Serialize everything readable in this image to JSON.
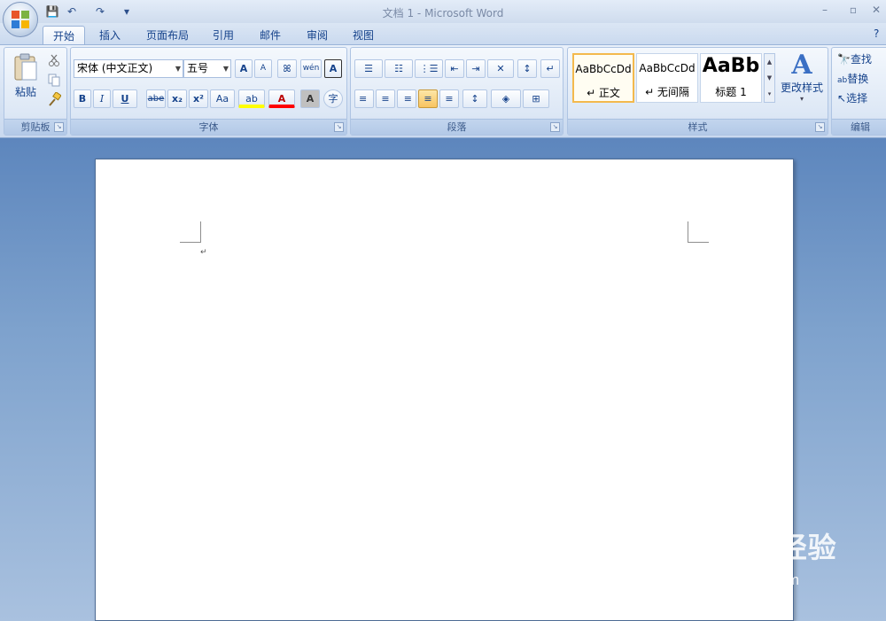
{
  "window": {
    "title": "文档 1 - Microsoft Word",
    "min": "–",
    "restore": "▫",
    "close": "✕"
  },
  "qat": {
    "save": "💾",
    "undo": "↶",
    "redo": "↷",
    "customize": "▾"
  },
  "tabs": [
    "开始",
    "插入",
    "页面布局",
    "引用",
    "邮件",
    "审阅",
    "视图"
  ],
  "help": "?",
  "clipboard": {
    "label": "剪贴板",
    "paste": "粘贴"
  },
  "font": {
    "label": "字体",
    "name": "宋体 (中文正文)",
    "size": "五号",
    "grow": "A",
    "shrink": "A",
    "clear": "ꕤ",
    "phonetic": "wén",
    "border": "A",
    "bold": "B",
    "italic": "I",
    "underline": "U",
    "strike": "abe",
    "sub": "x₂",
    "sup": "x²",
    "case": "Aa",
    "highlight": "ab",
    "color": "A",
    "shade": "A",
    "enclose": "字"
  },
  "paragraph": {
    "label": "段落",
    "bullets": "☰",
    "numbers": "☷",
    "multilevel": "⋮☰",
    "dec_indent": "⇤",
    "inc_indent": "⇥",
    "chinese": "✕",
    "sort": "↕",
    "show": "↵",
    "left": "≡",
    "center": "≡",
    "right": "≡",
    "justify": "≡",
    "distribute": "≡",
    "spacing": "↕",
    "shading": "◈",
    "borders": "⊞"
  },
  "styles": {
    "label": "样式",
    "items": [
      {
        "sample": "AaBbCcDd",
        "name": "↵ 正文"
      },
      {
        "sample": "AaBbCcDd",
        "name": "↵ 无间隔"
      },
      {
        "sample": "AaBb",
        "name": "标题 1"
      }
    ],
    "change": "更改样式"
  },
  "editing": {
    "label": "编辑",
    "find": "查找",
    "replace": "替换",
    "select": "选择"
  },
  "doc": {
    "paragraph_mark": "↵"
  },
  "watermark": {
    "brand": "Bai du 经验",
    "url": "jingyan.baidu.com"
  },
  "colors": {
    "accent": "#15428b",
    "highlight": "#ffff00",
    "font_color": "#ff0000",
    "selected": "#f8c460"
  }
}
